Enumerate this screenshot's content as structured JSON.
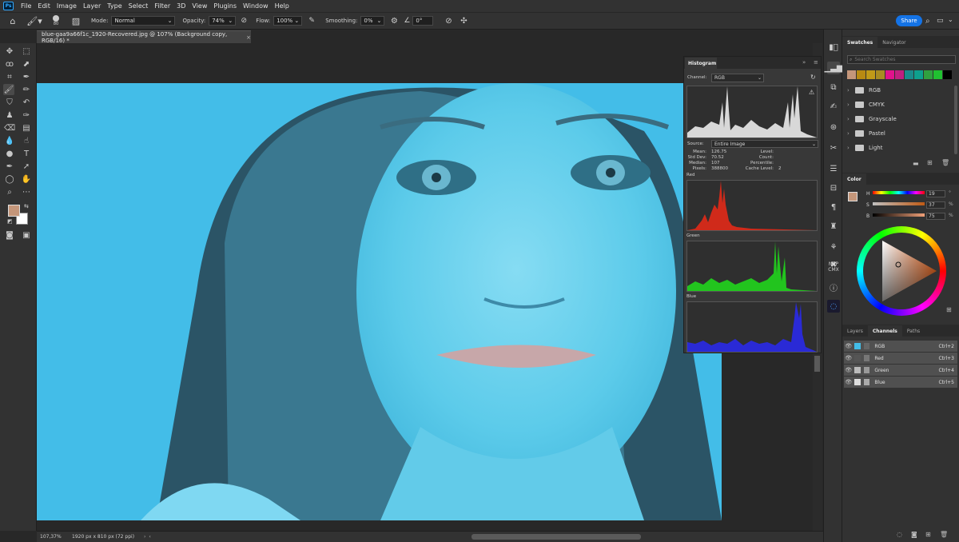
{
  "menu": [
    "File",
    "Edit",
    "Image",
    "Layer",
    "Type",
    "Select",
    "Filter",
    "3D",
    "View",
    "Plugins",
    "Window",
    "Help"
  ],
  "app_badge": "Ps",
  "options": {
    "brush_size": "80",
    "mode_label": "Mode:",
    "mode_value": "Normal",
    "opacity_label": "Opacity:",
    "opacity_value": "74%",
    "flow_label": "Flow:",
    "flow_value": "100%",
    "smoothing_label": "Smoothing:",
    "smoothing_value": "0%",
    "angle_value": "0°",
    "share_label": "Share"
  },
  "document": {
    "tab_title": "blue-gaa9a66f1c_1920-Recovered.jpg @ 107% (Background copy, RGB/16) *",
    "zoom": "107,37%",
    "info": "1920 px x 810 px (72 ppi)"
  },
  "histogram": {
    "title": "Histogram",
    "channel_label": "Channel:",
    "channel_value": "RGB",
    "source_label": "Source:",
    "source_value": "Entire Image",
    "stats_left_labels": [
      "Mean:",
      "Std Dev:",
      "Median:",
      "Pixels:"
    ],
    "stats_left_values": [
      "126.75",
      "70.52",
      "107",
      "388800"
    ],
    "stats_right_labels": [
      "Level:",
      "Count:",
      "Percentile:",
      "Cache Level:"
    ],
    "stats_right_values": [
      "",
      "",
      "",
      "2"
    ],
    "red_label": "Red",
    "green_label": "Green",
    "blue_label": "Blue"
  },
  "swatches": {
    "tab_active": "Swatches",
    "tab_other": "Navigator",
    "search_placeholder": "Search Swatches",
    "colors": [
      "#c4967a",
      "#b88a12",
      "#c09a18",
      "#a88c22",
      "#e0128c",
      "#c02080",
      "#1a8c8c",
      "#0ea08e",
      "#30a040",
      "#20c030",
      "#000000"
    ],
    "folders": [
      "RGB",
      "CMYK",
      "Grayscale",
      "Pastel",
      "Light"
    ]
  },
  "color": {
    "tab": "Color",
    "h_label": "H",
    "h_value": "19",
    "s_label": "S",
    "s_value": "37",
    "b_label": "B",
    "b_value": "75",
    "pct": "%",
    "deg": "°",
    "foreground": "#c4967a"
  },
  "layers": {
    "tabs": [
      "Layers",
      "Channels",
      "Paths"
    ],
    "active_tab": "Channels",
    "channels": [
      {
        "name": "RGB",
        "shortcut": "Ctrl+2"
      },
      {
        "name": "Red",
        "shortcut": "Ctrl+3"
      },
      {
        "name": "Green",
        "shortcut": "Ctrl+4"
      },
      {
        "name": "Blue",
        "shortcut": "Ctrl+5"
      }
    ]
  },
  "right_strip": {
    "nbp_top": "NBP",
    "nbp_bottom": "CMX"
  },
  "colors": {
    "accent": "#1473e6",
    "panel": "#323232",
    "photo_cyan": "#52c8ec"
  }
}
